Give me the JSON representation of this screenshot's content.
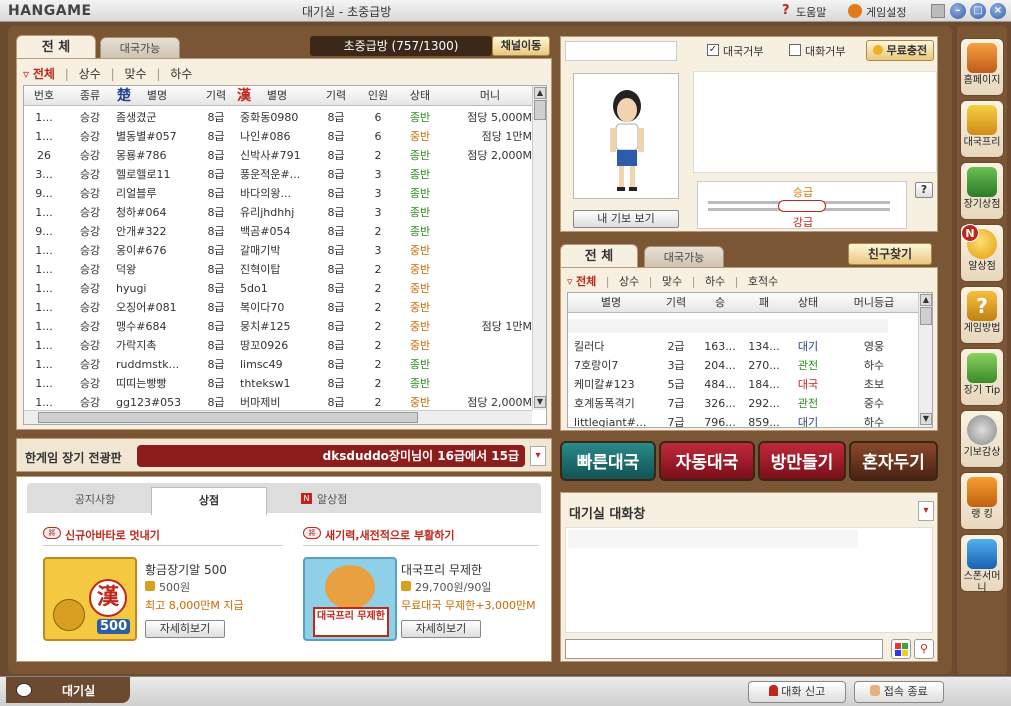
{
  "window": {
    "logo": "HANGAME",
    "title": "대기실 - 초중급방",
    "help": "도움말",
    "settings": "게임설정"
  },
  "room_list": {
    "tabs": [
      "전 체",
      "대국가능"
    ],
    "room_name": "초중급방 (757/1300)",
    "channel_button": "채널이동",
    "filters": [
      "전체",
      "상수",
      "맞수",
      "하수"
    ],
    "header_icon_cho": "楚",
    "header_icon_han": "漢",
    "headers": [
      "번호",
      "종류",
      "별명",
      "기력",
      "별명",
      "기력",
      "인원",
      "상태",
      "머니"
    ],
    "rows": [
      [
        "1...",
        "승강",
        "좀생겼군",
        "8급",
        "중화동0980",
        "8급",
        "6",
        "종반",
        "점당 5,000M"
      ],
      [
        "1...",
        "승강",
        "별동별#057",
        "8급",
        "나인#086",
        "8급",
        "6",
        "중반",
        "점당 1만M"
      ],
      [
        "26",
        "승강",
        "몽룡#786",
        "8급",
        "신박사#791",
        "8급",
        "2",
        "종반",
        "점당 2,000M"
      ],
      [
        "3...",
        "승강",
        "헬로헬로11",
        "8급",
        "풍운적운#...",
        "8급",
        "3",
        "종반",
        ""
      ],
      [
        "9...",
        "승강",
        "리얼블루",
        "8급",
        "바다의왕...",
        "8급",
        "3",
        "종반",
        ""
      ],
      [
        "1...",
        "승강",
        "청하#064",
        "8급",
        "유리jhdhhj",
        "8급",
        "3",
        "종반",
        ""
      ],
      [
        "9...",
        "승강",
        "안개#322",
        "8급",
        "백곰#054",
        "8급",
        "2",
        "종반",
        ""
      ],
      [
        "1...",
        "승강",
        "옹이#676",
        "8급",
        "갈매기박",
        "8급",
        "3",
        "중반",
        ""
      ],
      [
        "1...",
        "승강",
        "덕왕",
        "8급",
        "진혁이탑",
        "8급",
        "2",
        "중반",
        ""
      ],
      [
        "1...",
        "승강",
        "hyugi",
        "8급",
        "5do1",
        "8급",
        "2",
        "중반",
        ""
      ],
      [
        "1...",
        "승강",
        "오징어#081",
        "8급",
        "복이다70",
        "8급",
        "2",
        "중반",
        ""
      ],
      [
        "1...",
        "승강",
        "맹수#684",
        "8급",
        "뭉치#125",
        "8급",
        "2",
        "중반",
        "점당 1만M"
      ],
      [
        "1...",
        "승강",
        "가락지촉",
        "8급",
        "땅꼬0926",
        "8급",
        "2",
        "중반",
        ""
      ],
      [
        "1...",
        "승강",
        "ruddmstk...",
        "8급",
        "limsc49",
        "8급",
        "2",
        "종반",
        ""
      ],
      [
        "1...",
        "승강",
        "띠띠는빵빵",
        "8급",
        "thteksw1",
        "8급",
        "2",
        "종반",
        ""
      ],
      [
        "1...",
        "승강",
        "gg123#053",
        "8급",
        "버마제비",
        "8급",
        "2",
        "중반",
        "점당 2,000M"
      ]
    ]
  },
  "profile": {
    "reject_game": "대국거부",
    "reject_chat": "대화거부",
    "free_charge": "무료충전",
    "my_record": "내 기보 보기",
    "rank_up": "승급",
    "rank_down": "강급",
    "help_mark": "?"
  },
  "user_list": {
    "tabs": [
      "전 체",
      "대국가능"
    ],
    "find_friend": "친구찾기",
    "filters": [
      "전체",
      "상수",
      "맞수",
      "하수",
      "호적수"
    ],
    "headers": [
      "별명",
      "기력",
      "승",
      "패",
      "상태",
      "머니등급"
    ],
    "rows": [
      [
        "킬러다",
        "2급",
        "163...",
        "134...",
        "대기",
        "영웅"
      ],
      [
        "7호랑이7",
        "3급",
        "204...",
        "270...",
        "관전",
        "하수"
      ],
      [
        "케미칼#123",
        "5급",
        "484...",
        "184...",
        "대국",
        "초보"
      ],
      [
        "호계동폭격기",
        "7급",
        "326...",
        "292...",
        "관전",
        "중수"
      ],
      [
        "littlegiant#...",
        "7급",
        "796...",
        "859...",
        "대기",
        "하수"
      ]
    ]
  },
  "news": {
    "title": "한게임 장기 전광판",
    "ticker": "dksduddo장미님이 16급에서 15급",
    "tabs": [
      "공지사항",
      "상점",
      "알상점"
    ],
    "promo_left_label": "신규아바타로 멋내기",
    "promo_right_label": "새기력,새전적으로 부활하기",
    "item1_name": "황금장기알 500",
    "item1_price": "500원",
    "item1_desc": "최고 8,000만M 지급",
    "item1_detail": "자세히보기",
    "item1_badge": "500",
    "item1_han": "漢",
    "item2_name": "대국프리 무제한",
    "item2_price": "29,700원/90일",
    "item2_desc": "무료대국 무제한+3,000만M",
    "item2_detail": "자세히보기",
    "item2_badge": "대국프리 무제한"
  },
  "actions": {
    "quick": "빠른대국",
    "auto": "자동대국",
    "create": "방만들기",
    "solo": "혼자두기"
  },
  "chat": {
    "title": "대기실 대화창"
  },
  "sidebar": {
    "new_badge": "N",
    "items": [
      "홈페이지",
      "대국프리",
      "장기상점",
      "알상점",
      "게임방법",
      "장기 Tip",
      "기보감상",
      "랭 킹",
      "스폰서머니"
    ]
  },
  "bottom": {
    "tab": "대기실",
    "report": "대화 신고",
    "exit": "접속 종료"
  }
}
